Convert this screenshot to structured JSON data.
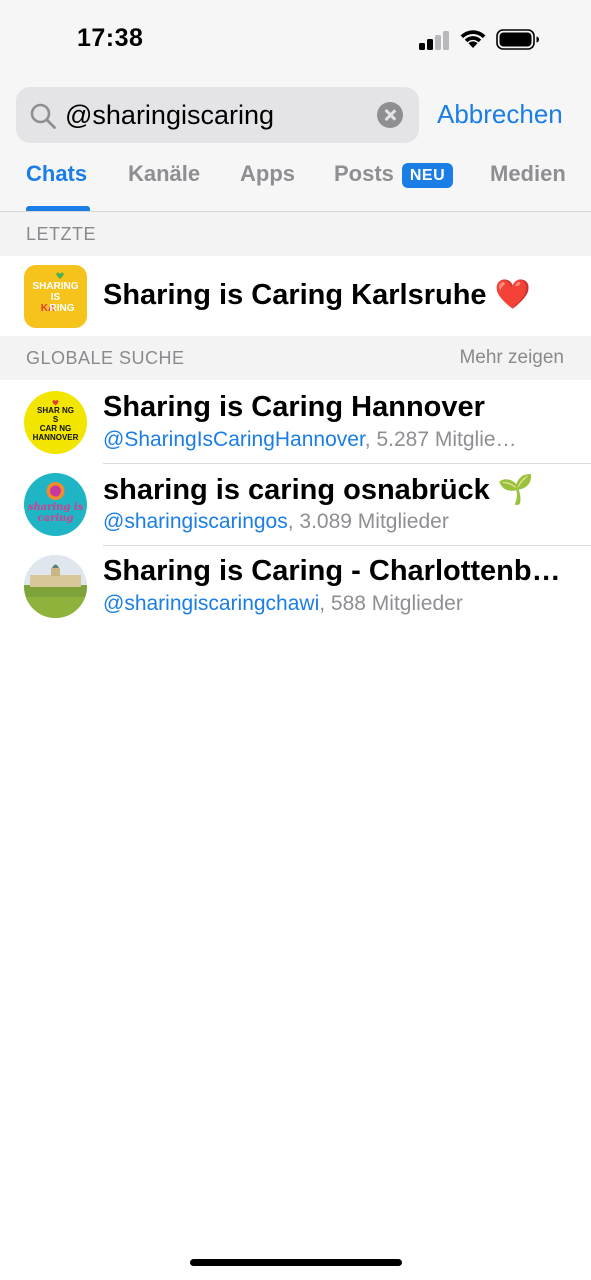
{
  "status_bar": {
    "time": "17:38"
  },
  "search": {
    "query": "@sharingiscaring",
    "cancel_label": "Abbrechen"
  },
  "tabs": [
    {
      "label": "Chats",
      "active": true
    },
    {
      "label": "Kanäle"
    },
    {
      "label": "Apps"
    },
    {
      "label": "Posts",
      "badge": "NEU"
    },
    {
      "label": "Medien"
    }
  ],
  "recent": {
    "header": "LETZTE",
    "items": [
      {
        "title": "Sharing is Caring Karlsruhe ❤️"
      }
    ]
  },
  "global": {
    "header": "GLOBALE SUCHE",
    "more_label": "Mehr zeigen",
    "items": [
      {
        "title": "Sharing is Caring Hannover",
        "handle": "@SharingIsCaringHannover",
        "members": ", 5.287 Mitglie…"
      },
      {
        "title": "sharing is caring osnabrück 🌱",
        "handle": "@sharingiscaringos",
        "members": ", 3.089 Mitglieder"
      },
      {
        "title": "Sharing is Caring - Charlottenb…",
        "handle": "@sharingiscaringchawi",
        "members": ", 588 Mitglieder"
      }
    ]
  },
  "colors": {
    "accent": "#1a7ee6",
    "secondary_text": "#8e8e93",
    "header_bg": "#f6f6f6"
  }
}
